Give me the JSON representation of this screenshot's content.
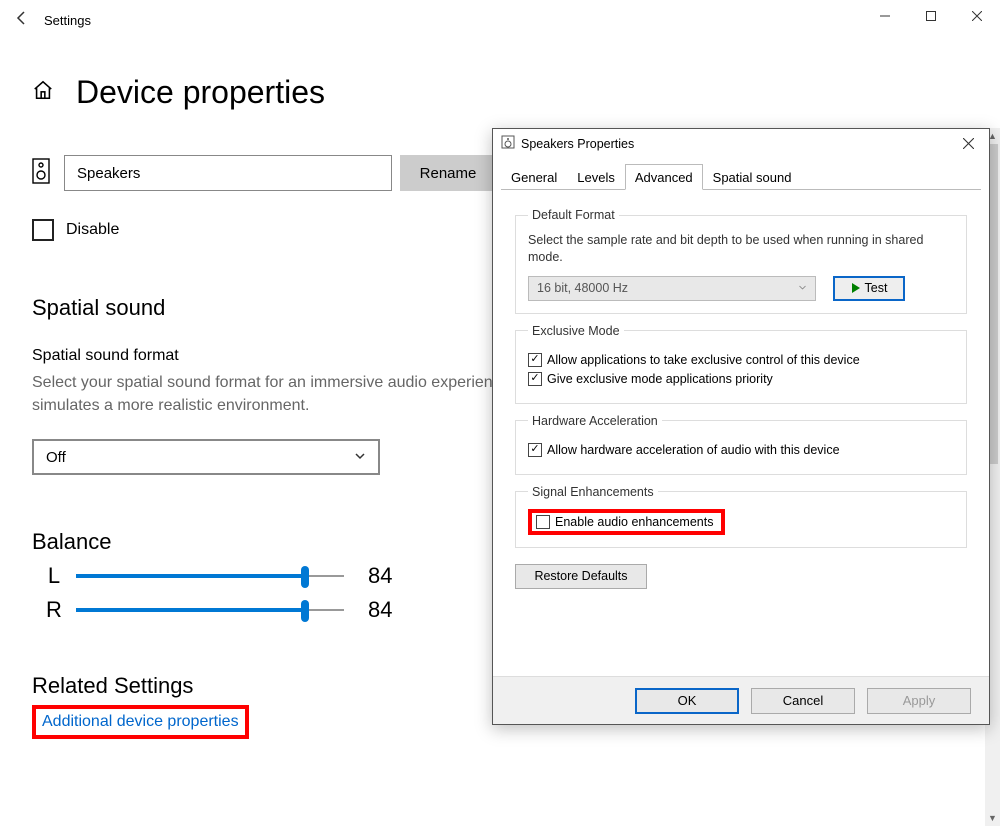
{
  "window": {
    "title": "Settings"
  },
  "page": {
    "heading": "Device properties",
    "device_name": "Speakers",
    "rename_label": "Rename",
    "disable_label": "Disable",
    "spatial": {
      "heading": "Spatial sound",
      "format_label": "Spatial sound format",
      "help": "Select your spatial sound format for an immersive audio experience that simulates a more realistic environment.",
      "value": "Off"
    },
    "balance": {
      "heading": "Balance",
      "left_label": "L",
      "right_label": "R",
      "left_value": "84",
      "right_value": "84"
    },
    "related": {
      "heading": "Related Settings",
      "link": "Additional device properties"
    }
  },
  "dialog": {
    "title": "Speakers Properties",
    "tabs": [
      "General",
      "Levels",
      "Advanced",
      "Spatial sound"
    ],
    "active_tab": "Advanced",
    "default_format": {
      "legend": "Default Format",
      "text": "Select the sample rate and bit depth to be used when running in shared mode.",
      "value": "16 bit, 48000 Hz",
      "test_label": "Test"
    },
    "exclusive": {
      "legend": "Exclusive Mode",
      "opt1": "Allow applications to take exclusive control of this device",
      "opt2": "Give exclusive mode applications priority"
    },
    "hwaccel": {
      "legend": "Hardware Acceleration",
      "opt1": "Allow hardware acceleration of audio with this device"
    },
    "signal": {
      "legend": "Signal Enhancements",
      "opt1": "Enable audio enhancements"
    },
    "restore_label": "Restore Defaults",
    "ok_label": "OK",
    "cancel_label": "Cancel",
    "apply_label": "Apply"
  }
}
